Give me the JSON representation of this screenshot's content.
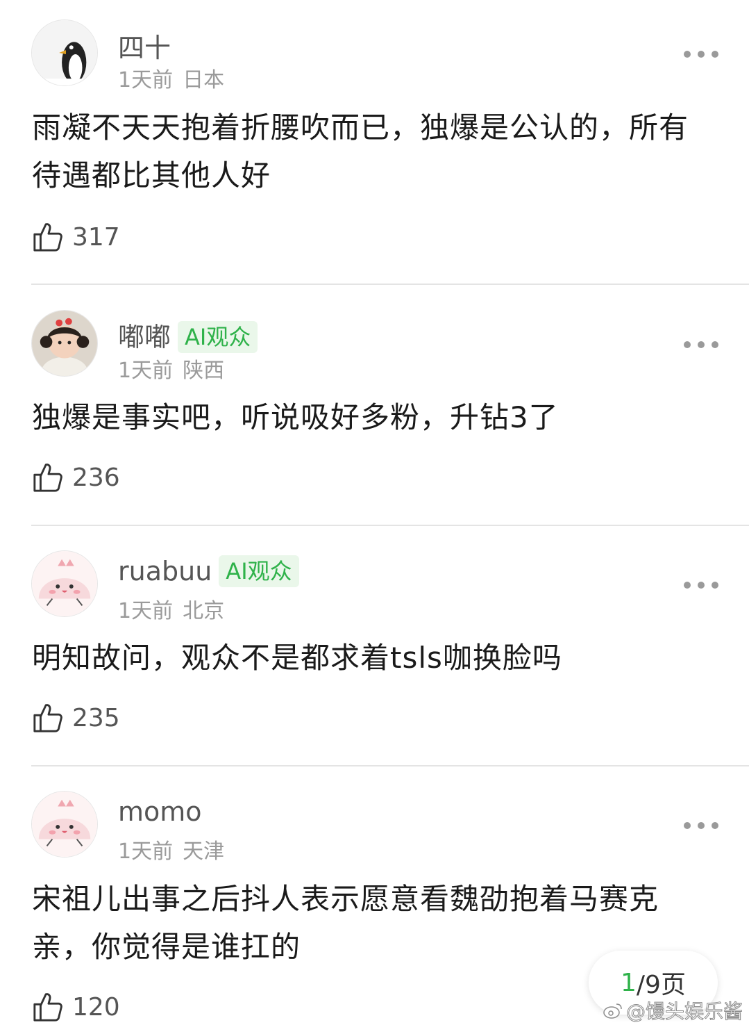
{
  "comments": [
    {
      "username": "四十",
      "badge": "",
      "time": "1天前",
      "location": "日本",
      "content": "雨凝不天天抱着折腰吹而已，独爆是公认的，所有待遇都比其他人好",
      "likes": "317",
      "avatar_icon": "penguin-avatar"
    },
    {
      "username": "嘟嘟",
      "badge": "AI观众",
      "time": "1天前",
      "location": "陕西",
      "content": "独爆是事实吧，听说吸好多粉，升钻3了",
      "likes": "236",
      "avatar_icon": "child-photo-avatar"
    },
    {
      "username": "ruabuu",
      "badge": "AI观众",
      "time": "1天前",
      "location": "北京",
      "content": "明知故问，观众不是都求着tsls咖换脸吗",
      "likes": "235",
      "avatar_icon": "pink-cartoon-avatar"
    },
    {
      "username": "momo",
      "badge": "",
      "time": "1天前",
      "location": "天津",
      "content": "宋祖儿出事之后抖人表示愿意看魏劭抱着马赛克亲，你觉得是谁扛的",
      "likes": "120",
      "avatar_icon": "pink-cartoon-avatar"
    }
  ],
  "pager": {
    "current": "1",
    "rest": "/9页"
  },
  "watermark": {
    "text": "@馒头娱乐酱",
    "icon": "weibo-icon"
  },
  "colors": {
    "accent_green": "#2fb24a",
    "badge_bg": "#eaf7ea",
    "meta_gray": "#9a9a9a"
  }
}
